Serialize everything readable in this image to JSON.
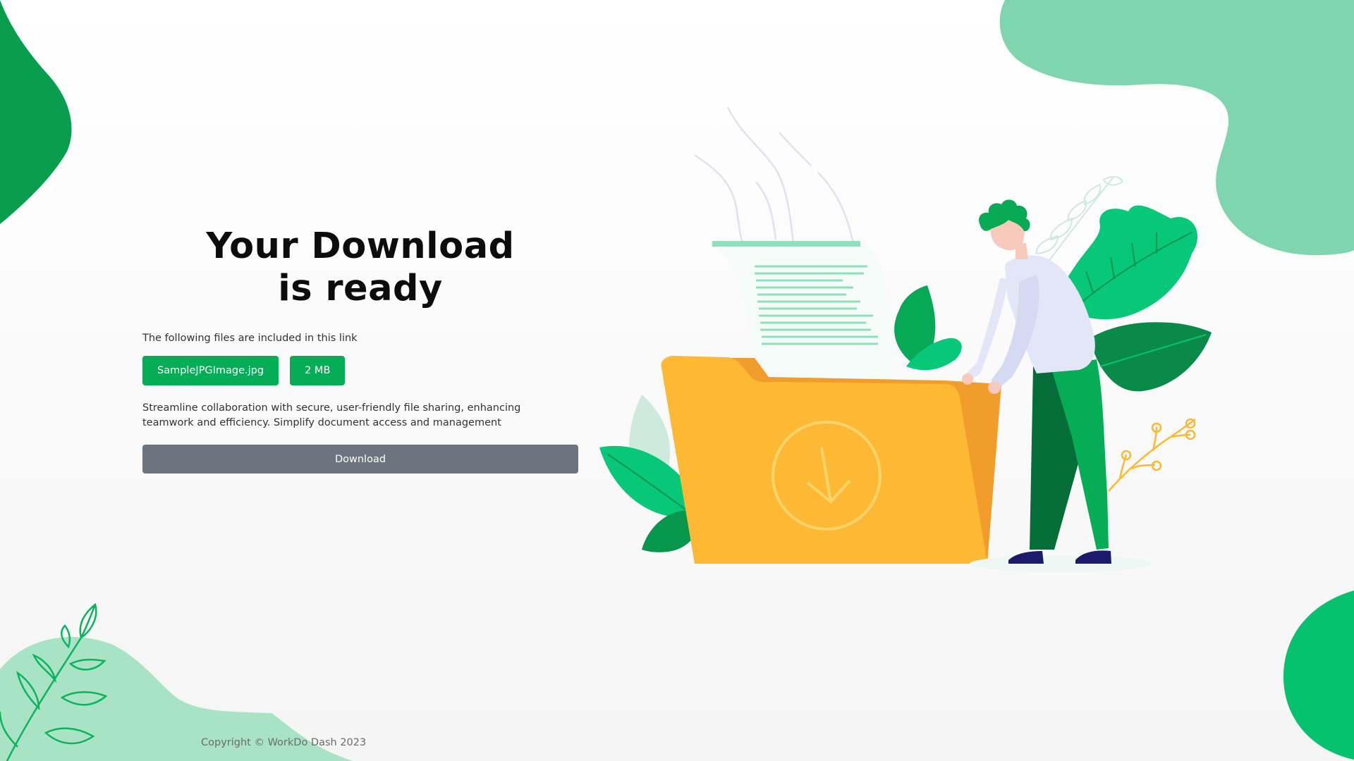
{
  "header": {
    "title_line1": "Your Download",
    "title_line2": "is ready"
  },
  "files": {
    "intro": "The following files are included in this link",
    "file_name": "SampleJPGImage.jpg",
    "file_size": "2 MB"
  },
  "description": "Streamline collaboration with secure, user-friendly file sharing, enhancing teamwork and efficiency. Simplify document access and management",
  "actions": {
    "download_label": "Download"
  },
  "footer": {
    "copyright": "Copyright © WorkDo Dash 2023"
  },
  "colors": {
    "brand_green": "#06ad57",
    "button_gray": "#6c757d",
    "folder_yellow": "#fdb933",
    "light_green": "#7fd5ae"
  },
  "icons": {
    "illustration": "folder-download-illustration"
  }
}
